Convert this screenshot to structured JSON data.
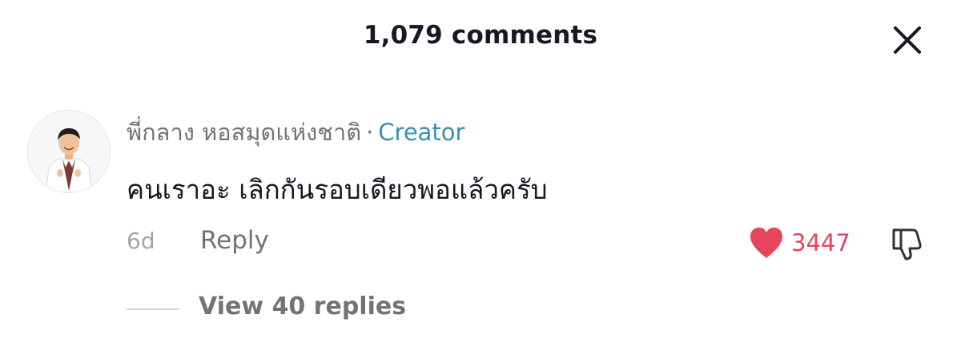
{
  "header": {
    "title": "1,079 comments",
    "close_icon": "close-icon"
  },
  "comment": {
    "author": "พี่กลาง หอสมุดแห่งชาติ",
    "separator": "·",
    "badge": "Creator",
    "text": "คนเราอะ เลิกกันรอบเดียวพอแล้วครับ",
    "time": "6d",
    "reply_label": "Reply",
    "like_count": "3447",
    "like_icon": "heart-icon",
    "dislike_icon": "thumbs-down-icon"
  },
  "replies": {
    "view_label": "View 40 replies"
  },
  "colors": {
    "text_primary": "#161823",
    "text_secondary": "#737373",
    "creator_badge": "#3a8fb3",
    "like": "#e5455d"
  }
}
